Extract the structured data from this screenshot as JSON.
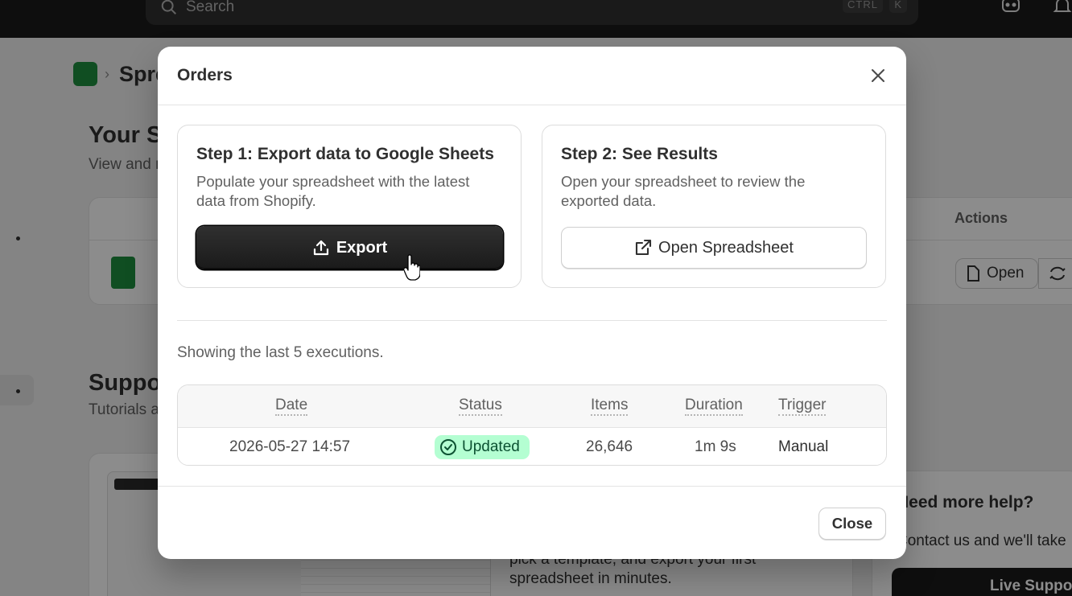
{
  "topbar": {
    "search_placeholder": "Search",
    "kbd_ctrl": "CTRL",
    "kbd_k": "K"
  },
  "background": {
    "breadcrumb": "Spreadsheets",
    "heading": "Your Spreadsheets",
    "subheading": "View and manage your exports",
    "actions_header": "Actions",
    "open_button": "Open",
    "support_heading": "Support",
    "tutorials_text": "Tutorials and guides",
    "template_text": "pick a template, and export your first spreadsheet in minutes.",
    "help_heading": "Need more help?",
    "help_text": "Contact us and we'll take",
    "live_support": "Live Support"
  },
  "modal": {
    "title": "Orders",
    "step1": {
      "title": "Step 1: Export data to Google Sheets",
      "description": "Populate your spreadsheet with the latest data from Shopify.",
      "button": "Export"
    },
    "step2": {
      "title": "Step 2: See Results",
      "description": "Open your spreadsheet to review the exported data.",
      "button": "Open Spreadsheet"
    },
    "showing_text": "Showing the last 5 executions.",
    "table": {
      "headers": {
        "date": "Date",
        "status": "Status",
        "items": "Items",
        "duration": "Duration",
        "trigger": "Trigger"
      },
      "rows": [
        {
          "date": "2026-05-27 14:57",
          "status": "Updated",
          "items": "26,646",
          "duration": "1m 9s",
          "trigger": "Manual"
        }
      ]
    },
    "close_button": "Close"
  },
  "colors": {
    "primary_button": "#1a1a1a",
    "success_badge_bg": "#b4fed2",
    "success_badge_text": "#0c5132",
    "sheets_green": "#1e8e3e"
  }
}
